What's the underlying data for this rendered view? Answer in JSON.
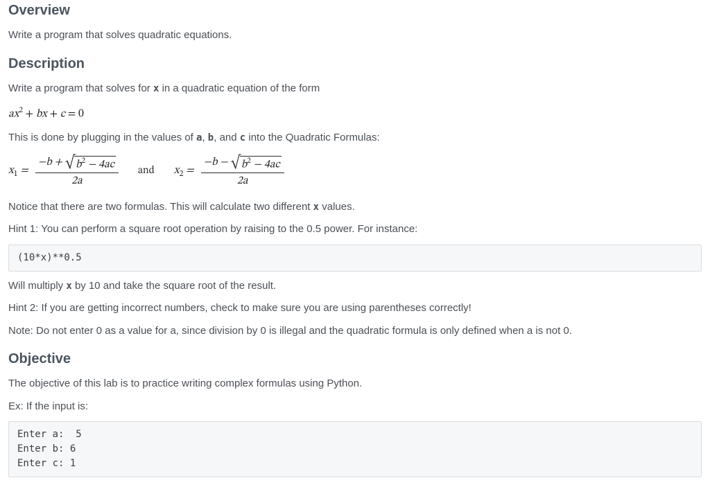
{
  "headings": {
    "overview": "Overview",
    "description": "Description",
    "objective": "Objective"
  },
  "overview": {
    "intro": "Write a program that solves quadratic equations."
  },
  "description": {
    "lead": "Write a program that solves for ",
    "lead_var": "x",
    "lead_tail": " in a quadratic equation of the form",
    "std_form_a": "a",
    "std_form_x": "x",
    "std_form_sq": "2",
    "std_form_plus1": " + ",
    "std_form_b": "b",
    "std_form_x2": "x",
    "std_form_plus2": " + ",
    "std_form_c": "c",
    "std_form_eq": " = 0",
    "plugging_pre": "This is done by plugging in the values of ",
    "plugging_a": "a",
    "plugging_sep1": ", ",
    "plugging_b": "b",
    "plugging_sep2": ", and ",
    "plugging_c": "c",
    "plugging_post": " into the Quadratic Formulas:",
    "x1_label_x": "x",
    "x1_label_sub": "1",
    "eq_sign": " = ",
    "num1_pre": "−b + ",
    "disc_b": "b",
    "disc_sq": "2",
    "disc_minus": " − 4",
    "disc_a": "a",
    "disc_c": "c",
    "den_two": "2",
    "den_a": "a",
    "and_word": "and",
    "x2_label_x": "x",
    "x2_label_sub": "2",
    "num2_pre": "−b − ",
    "notice": "Notice that there are two formulas. This will calculate two different ",
    "notice_var": "x",
    "notice_tail": " values.",
    "hint1": "Hint 1: You can perform a square root operation by raising to the 0.5 power. For instance:",
    "code1": "(10*x)**0.5",
    "will_mult_pre": "Will multiply ",
    "will_mult_var": "x",
    "will_mult_post": " by 10 and take the square root of the result.",
    "hint2": "Hint 2: If you are getting incorrect numbers, check to make sure you are using parentheses correctly!",
    "note": "Note: Do not enter 0 as a value for a, since division by 0 is illegal and the quadratic formula is only defined when a is not 0."
  },
  "objective": {
    "text": "The objective of this lab is to practice writing complex formulas using Python.",
    "ex_label": "Ex: If the input is:",
    "example_io": "Enter a:  5\nEnter b: 6\nEnter c: 1"
  }
}
